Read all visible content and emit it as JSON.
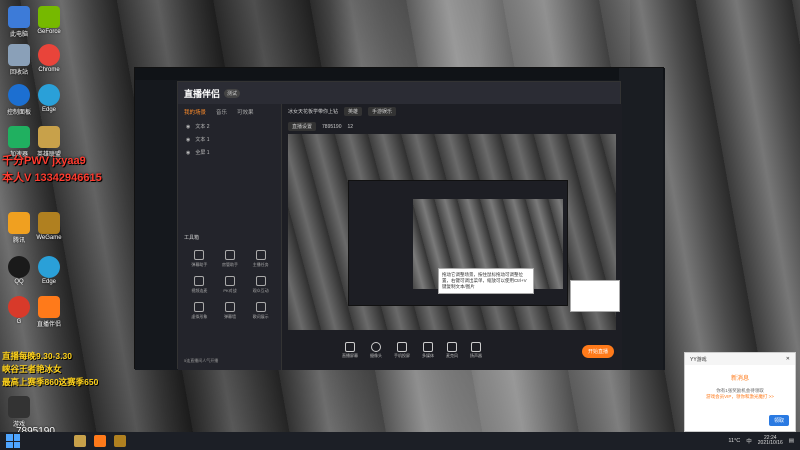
{
  "desktop": {
    "icons": [
      {
        "label": "此电脑",
        "color": "#3d7bd8"
      },
      {
        "label": "GeForce",
        "color": "#76b900"
      },
      {
        "label": "回收站",
        "color": "#8aa0b8"
      },
      {
        "label": "Chrome",
        "color": "#e9443a"
      },
      {
        "label": "控制面板",
        "color": "#1c6fd1"
      },
      {
        "label": "Edge",
        "color": "#2aa0d8"
      },
      {
        "label": "加速器",
        "color": "#20b060"
      },
      {
        "label": "英雄联盟",
        "color": "#c8a14a"
      },
      {
        "label": "腾讯",
        "color": "#f0a020"
      },
      {
        "label": "WeGame",
        "color": "#b08020"
      },
      {
        "label": "QQ",
        "color": "#1a1a1a"
      },
      {
        "label": "Edge",
        "color": "#2aa0d8"
      },
      {
        "label": "G",
        "color": "#d83a2a"
      },
      {
        "label": "直播伴侣",
        "color": "#ff7a1a"
      },
      {
        "label": "游戏",
        "color": "#333"
      }
    ],
    "overlay": {
      "line1": "千分PWV  jxyaa9",
      "line2": "本人V 13342946615",
      "line3": "直播每晚9.30-3.30",
      "line4": "峡谷王者艳冰女",
      "line5": "最高上赛季860这赛季650",
      "id": "7895190"
    }
  },
  "app": {
    "logo": "直播伴侣",
    "badge": "测试",
    "game_stats": {
      "coins": "4455"
    },
    "sidebar": {
      "tabs": [
        "我的场景",
        "音乐",
        "可效果"
      ],
      "layers": [
        "文本 2",
        "文本 1",
        "全屏 1"
      ],
      "tools_title": "工具箱",
      "tools": [
        "弹幕助手",
        "房管助手",
        "主播任务",
        "视频连麦",
        "PK对战",
        "观众互动",
        "虚拟形象",
        "弹幕墙",
        "歌词展示"
      ],
      "footer": "5连直播间人气开播"
    },
    "header": {
      "title": "冰女天花板学带你上钻",
      "category": "英雄",
      "room_label": "直播设置",
      "room_type": "手游娱乐",
      "room_id": "7895190",
      "fans": "12"
    },
    "preview_tip": "拖动它调整场景，按住鼠标拖动可调整位置，右键可调出菜单，缩放可以使用Ctrl+V键复制文本/图片",
    "bottom_buttons": [
      "直播屏幕",
      "摄像头",
      "手机投屏",
      "多媒体",
      "麦克风",
      "扬声器"
    ],
    "go_live": "开始直播",
    "status": {
      "cpu": "CPU:15%",
      "time": "00:00:00"
    }
  },
  "notification": {
    "source": "YY游戏",
    "title": "新消息",
    "body1": "你有1张奖励机会待领取",
    "link": "游戏会员VIP，领你和激光魔打 >>",
    "button": "领取"
  },
  "taskbar": {
    "weather": "11°C",
    "lang": "中",
    "time": "22:24",
    "date": "2021/10/16"
  }
}
